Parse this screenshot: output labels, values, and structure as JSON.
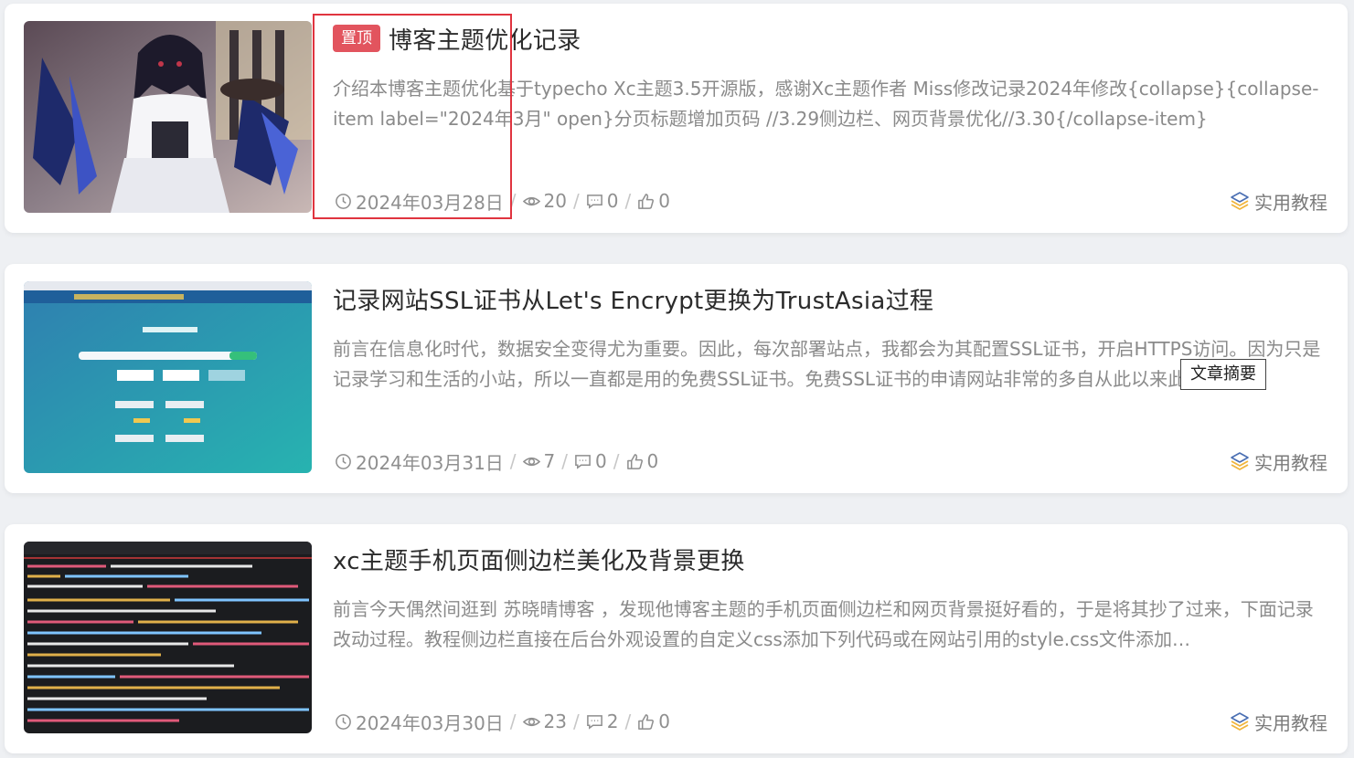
{
  "posts": [
    {
      "pinned_label": "置顶",
      "title": "博客主题优化记录",
      "excerpt": "介绍本博客主题优化基于typecho Xc主题3.5开源版，感谢Xc主题作者 Miss修改记录2024年修改{collapse}{collapse-item label=\"2024年3月\" open}分页标题增加页码 //3.29侧边栏、网页背景优化//3.30{/collapse-item}",
      "date": "2024年03月28日",
      "views": "20",
      "comments": "0",
      "likes": "0",
      "category": "实用教程",
      "thumb_icon": "anime-character-thumbnail"
    },
    {
      "title": "记录网站SSL证书从Let's Encrypt更换为TrustAsia过程",
      "excerpt": "前言在信息化时代，数据安全变得尤为重要。因此，每次部署站点，我都会为其配置SSL证书，开启HTTPS访问。因为只是记录学习和生活的小站，所以一直都是用的免费SSL证书。免费SSL证书的申请网站非常的多自从此以来此…",
      "date": "2024年03月31日",
      "views": "7",
      "comments": "0",
      "likes": "0",
      "category": "实用教程",
      "thumb_icon": "freessl-website-thumbnail"
    },
    {
      "title": "xc主题手机页面侧边栏美化及背景更换",
      "excerpt": "前言今天偶然间逛到 苏晓晴博客 ，发现他博客主题的手机页面侧边栏和网页背景挺好看的，于是将其抄了过来，下面记录改动过程。教程侧边栏直接在后台外观设置的自定义css添加下列代码或在网站引用的style.css文件添加…",
      "date": "2024年03月30日",
      "views": "23",
      "comments": "2",
      "likes": "0",
      "category": "实用教程",
      "thumb_icon": "css-code-thumbnail"
    }
  ],
  "tooltip": "文章摘要",
  "colors": {
    "pin_badge": "#e2545e",
    "highlight_box": "#e0343f",
    "category_icon_primary": "#f0b53c",
    "category_icon_secondary": "#4a6fb3"
  }
}
